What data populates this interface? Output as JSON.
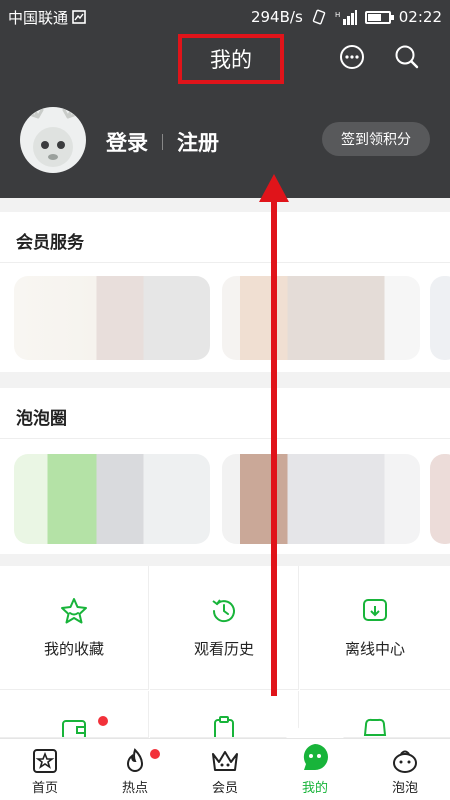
{
  "status": {
    "carrier": "中国联通",
    "speed": "294B/s",
    "time": "02:22",
    "battery_level": 0.6
  },
  "header": {
    "title": "我的",
    "login_label": "登录",
    "register_label": "注册",
    "checkin_label": "签到领积分",
    "icons": [
      "message-icon",
      "search-icon"
    ]
  },
  "sections": {
    "member_title": "会员服务",
    "bubble_title": "泡泡圈"
  },
  "features": [
    {
      "label": "我的收藏",
      "icon": "star-icon"
    },
    {
      "label": "观看历史",
      "icon": "history-clock-icon"
    },
    {
      "label": "离线中心",
      "icon": "download-icon"
    }
  ],
  "tabs": [
    {
      "label": "首页",
      "icon": "home-icon"
    },
    {
      "label": "热点",
      "icon": "flame-icon"
    },
    {
      "label": "会员",
      "icon": "crown-icon"
    },
    {
      "label": "我的",
      "icon": "me-icon"
    },
    {
      "label": "泡泡",
      "icon": "bubble-icon"
    }
  ],
  "colors": {
    "accent": "#18b43a",
    "header_bg": "#3b3c3e",
    "highlight": "#e0141a"
  }
}
